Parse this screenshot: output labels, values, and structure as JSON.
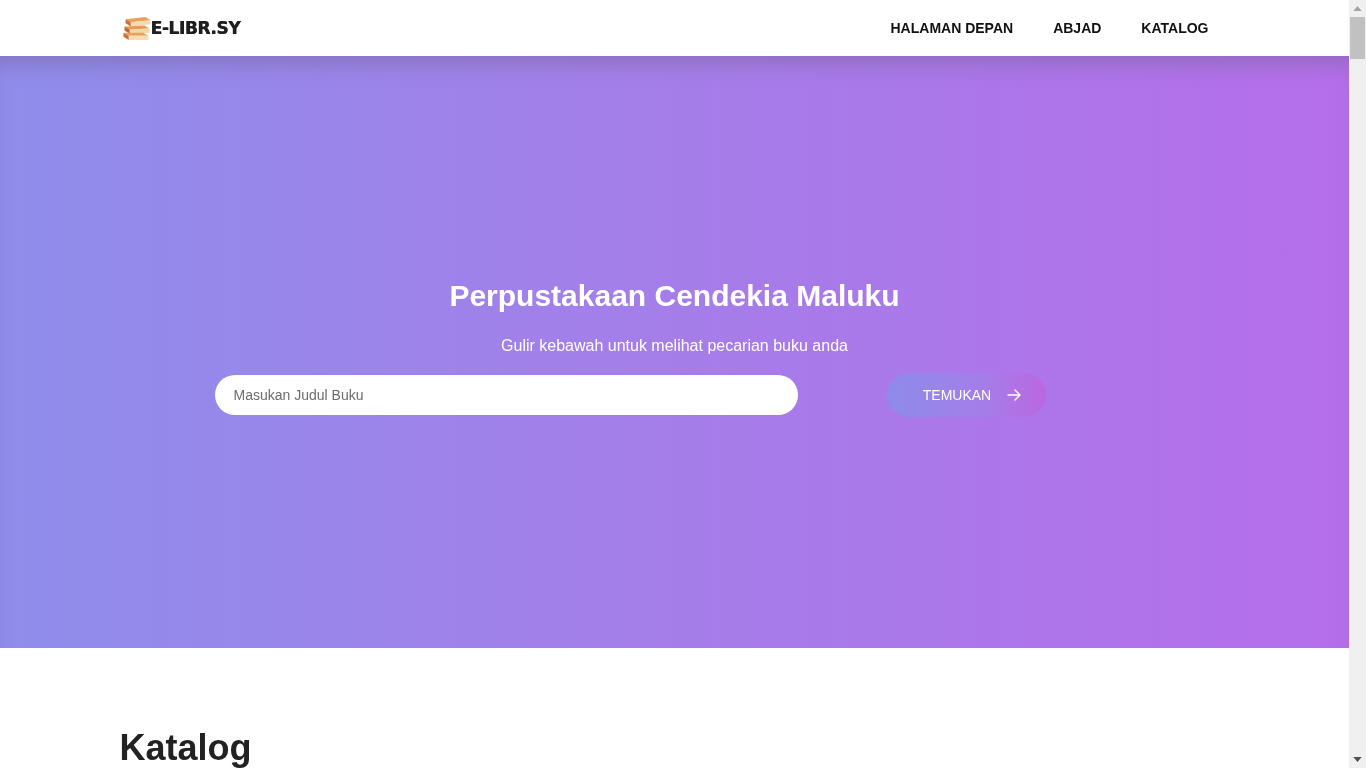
{
  "navbar": {
    "logo": "E-LIBR.SY",
    "links": [
      {
        "label": "HALAMAN DEPAN"
      },
      {
        "label": "ABJAD"
      },
      {
        "label": "KATALOG"
      }
    ]
  },
  "hero": {
    "title": "Perpustakaan Cendekia Maluku",
    "subtitle": "Gulir kebawah untuk melihat pecarian buku anda",
    "search": {
      "placeholder": "Masukan Judul Buku"
    },
    "button": "TEMUKAN"
  },
  "catalog": {
    "heading": "Katalog"
  }
}
